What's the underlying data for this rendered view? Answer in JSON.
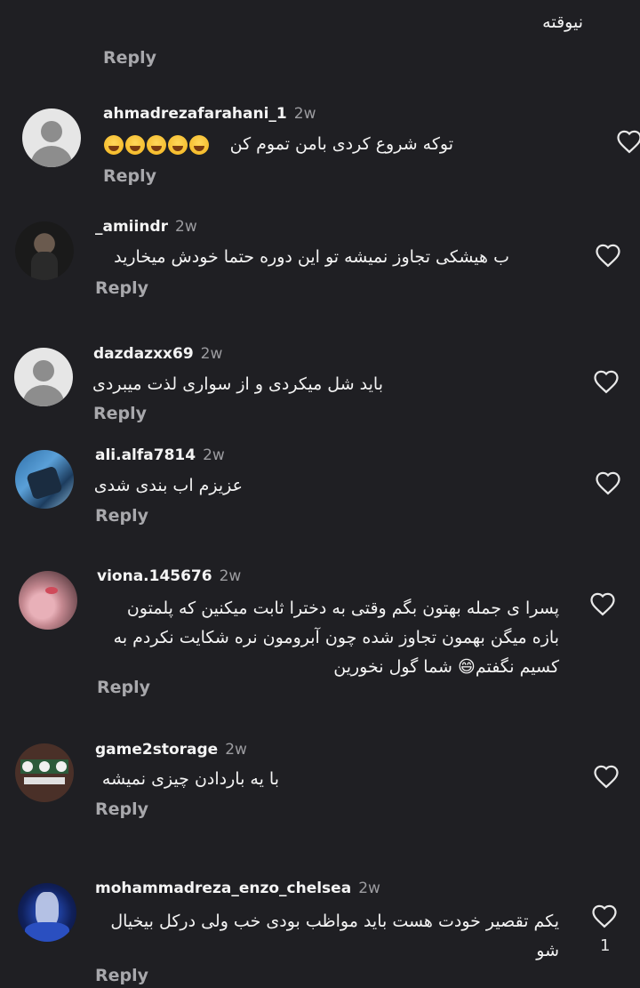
{
  "top": {
    "text": "نیوقته",
    "reply_label": "Reply"
  },
  "comments": [
    {
      "username": "ahmadrezafarahani_1",
      "time": "2w",
      "text": "توکه شروع کردی بامن تموم کن",
      "emoji": "grinning-sweat-emoji",
      "emoji_count": 5,
      "reply_label": "Reply",
      "avatar": "default-avatar"
    },
    {
      "username": "_amiindr",
      "time": "2w",
      "text": "ب هیشکی تجاوز نمیشه تو این دوره حتما خودش میخارید",
      "reply_label": "Reply",
      "avatar": "photo-avatar"
    },
    {
      "username": "dazdazxx69",
      "time": "2w",
      "text": "باید شل میکردی و از سواری لذت میبردی",
      "reply_label": "Reply",
      "avatar": "default-avatar"
    },
    {
      "username": "ali.alfa7814",
      "time": "2w",
      "text": "عزیزم اب بندی شدی",
      "reply_label": "Reply",
      "avatar": "photo-avatar"
    },
    {
      "username": "viona.145676",
      "time": "2w",
      "text_lines": [
        "پسرا ی جمله بهتون بگم وقتی به دخترا ثابت میکنین  که پلمتون",
        "بازه میگن بهمون تجاوز شده چون آبرومون نره شکایت نکردم به",
        "کسیم نگفتم😄 شما گول نخورین"
      ],
      "reply_label": "Reply",
      "avatar": "photo-avatar"
    },
    {
      "username": "game2storage",
      "time": "2w",
      "text": "با یه باردادن چیزی نمیشه",
      "reply_label": "Reply",
      "avatar": "photo-avatar"
    },
    {
      "username": "mohammadreza_enzo_chelsea",
      "time": "2w",
      "text_lines": [
        "یکم تقصیر خودت هست باید مواظب بودی خب ولی درکل بیخیال",
        "شو"
      ],
      "likes": "1",
      "reply_label": "Reply",
      "avatar": "photo-avatar"
    }
  ],
  "colors": {
    "background": "#1f1f23",
    "text": "#f4f4f4",
    "muted": "#a8a8ac"
  }
}
